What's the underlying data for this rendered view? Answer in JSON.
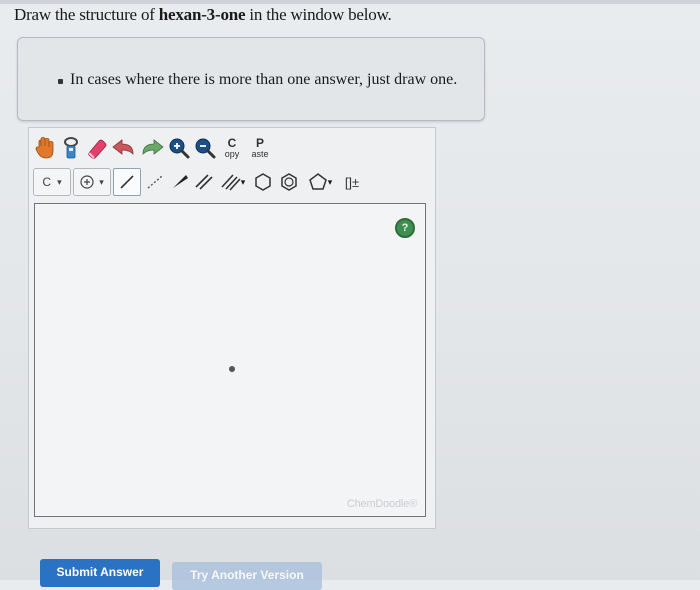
{
  "question": {
    "prefix": "Draw the structure of ",
    "compound": "hexan-3-one",
    "suffix": " in the window below."
  },
  "hint": {
    "text": "In cases where there is more than one answer, just draw one."
  },
  "toolbar": {
    "copy_big": "C",
    "copy_small": "opy",
    "paste_big": "P",
    "paste_small": "aste",
    "element_selector": "C",
    "dropdown_arrow": "▾",
    "bracket_label": "[]±"
  },
  "canvas": {
    "help_symbol": "?",
    "watermark": "ChemDoodle®"
  },
  "buttons": {
    "submit": "Submit Answer",
    "try_another": "Try Another Version"
  },
  "colors": {
    "submit_blue": "#2a73c4",
    "help_green": "#3f8f52",
    "hand_orange": "#e07a2a",
    "eraser_pink": "#e0426a",
    "zoom_blue": "#1c4f86"
  }
}
